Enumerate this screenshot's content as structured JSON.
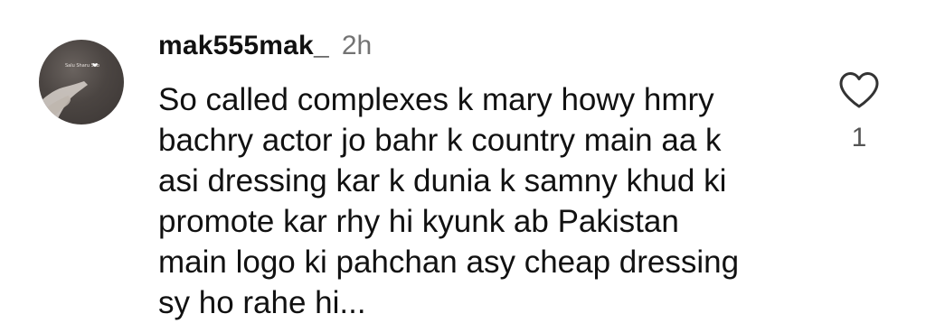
{
  "comment": {
    "username": "mak555mak_",
    "timestamp": "2h",
    "avatar_caption": "Salu Sharu Sab",
    "text_lines": [
      "So called complexes k mary howy hmry",
      "bachry actor jo bahr k country main aa k",
      "asi dressing kar k dunia k samny khud ki",
      "promote kar rhy hi kyunk ab Pakistan",
      "main logo ki pahchan asy cheap dressing",
      "sy ho rahe hi..."
    ],
    "like_count": "1",
    "like_icon": "heart-outline-icon"
  },
  "colors": {
    "text": "#111111",
    "timestamp": "#737373",
    "like_count": "#555555",
    "background": "#ffffff"
  }
}
